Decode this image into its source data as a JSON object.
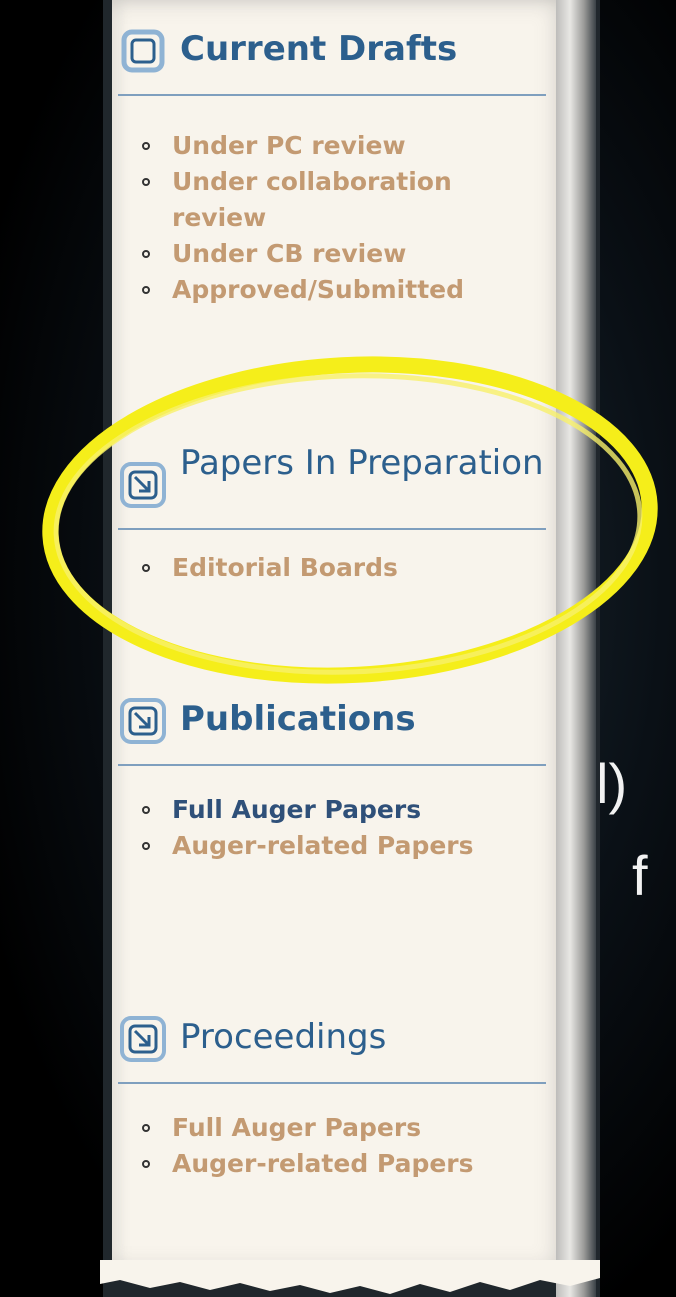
{
  "left_fragments": [
    {
      "text": "l)"
    },
    {
      "text": "f"
    }
  ],
  "sections": [
    {
      "heading": "Current Drafts",
      "icon": "arrow-in-box-icon",
      "items": [
        {
          "label": "Under PC review",
          "color": "#c39a72"
        },
        {
          "label": "Under collaboration review",
          "color": "#c39a72"
        },
        {
          "label": "Under CB review",
          "color": "#c39a72"
        },
        {
          "label": "Approved/Submitted",
          "color": "#c39a72"
        }
      ]
    },
    {
      "heading": "Papers In Preparation",
      "icon": "arrow-in-box-icon",
      "items": [
        {
          "label": "Editorial Boards",
          "color": "#c39a72"
        }
      ]
    },
    {
      "heading": "Publications",
      "icon": "arrow-in-box-icon",
      "items": [
        {
          "label": "Full Auger Papers",
          "color": "#2f5079"
        },
        {
          "label": "Auger-related Papers",
          "color": "#c39a72"
        }
      ]
    },
    {
      "heading": "Proceedings",
      "icon": "arrow-in-box-icon",
      "items": [
        {
          "label": "Full Auger Papers",
          "color": "#c39a72"
        },
        {
          "label": "Auger-related Papers",
          "color": "#c39a72"
        }
      ]
    }
  ],
  "highlight": {
    "color": "#f5ee1a",
    "target": "Papers In Preparation"
  }
}
